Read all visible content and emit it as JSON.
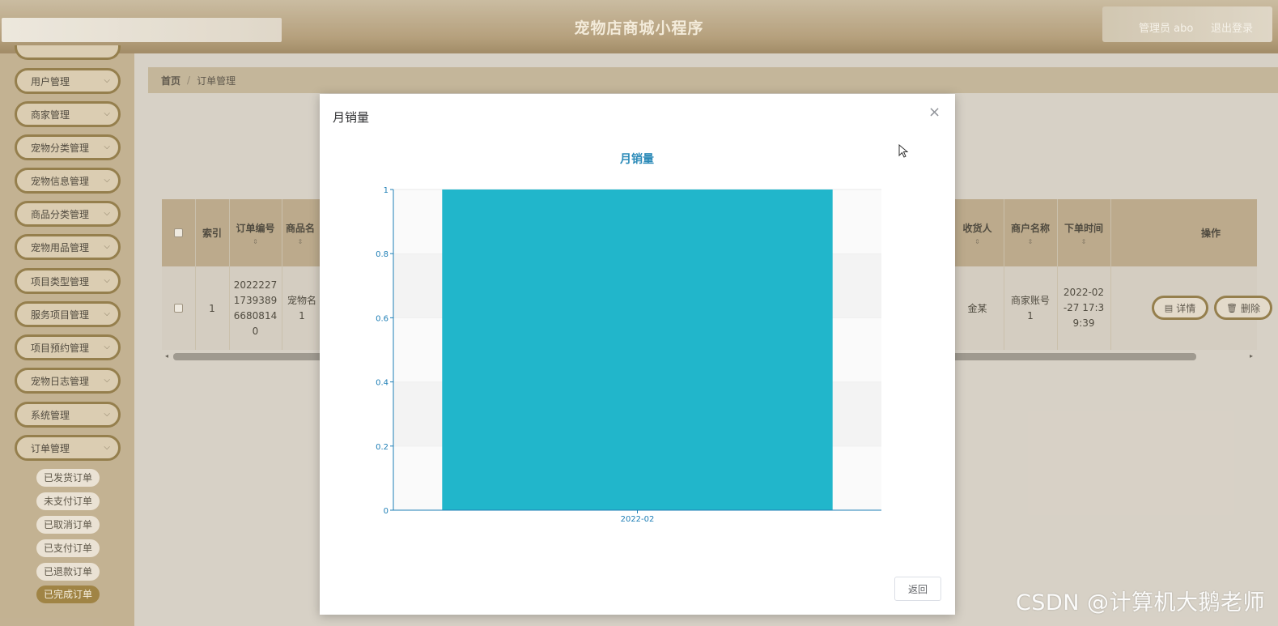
{
  "app": {
    "title": "宠物店商城小程序",
    "user": "管理员 abo",
    "logout": "退出登录"
  },
  "sidebar": {
    "items": [
      {
        "label": "用户管理"
      },
      {
        "label": "商家管理"
      },
      {
        "label": "宠物分类管理"
      },
      {
        "label": "宠物信息管理"
      },
      {
        "label": "商品分类管理"
      },
      {
        "label": "宠物用品管理"
      },
      {
        "label": "项目类型管理"
      },
      {
        "label": "服务项目管理"
      },
      {
        "label": "项目预约管理"
      },
      {
        "label": "宠物日志管理"
      },
      {
        "label": "系统管理"
      },
      {
        "label": "订单管理"
      }
    ],
    "sub_items": [
      {
        "label": "已发货订单",
        "active": false
      },
      {
        "label": "未支付订单",
        "active": false
      },
      {
        "label": "已取消订单",
        "active": false
      },
      {
        "label": "已支付订单",
        "active": false
      },
      {
        "label": "已退款订单",
        "active": false
      },
      {
        "label": "已完成订单",
        "active": true
      }
    ]
  },
  "breadcrumb": {
    "home": "首页",
    "separator": "/",
    "current": "订单管理"
  },
  "table": {
    "headers": {
      "index": "索引",
      "order_no": "订单编号",
      "goods_name": "商品名",
      "receiver": "收货人",
      "merchant_name": "商户名称",
      "order_time": "下单时间",
      "actions": "操作"
    },
    "sort_icon": "⇕",
    "row": {
      "index": "1",
      "order_no": "2022227173938966808140",
      "goods_name": "宠物名1",
      "receiver": "金某",
      "merchant_name": "商家账号1",
      "order_time": "2022-02-27 17:39:39",
      "detail_btn": "详情",
      "delete_btn": "删除"
    }
  },
  "modal": {
    "title": "月销量",
    "close": "×",
    "back_button": "返回"
  },
  "chart_data": {
    "type": "bar",
    "title": "月销量",
    "categories": [
      "2022-02"
    ],
    "values": [
      1
    ],
    "ylim": [
      0,
      1
    ],
    "yticks": [
      "0",
      "0.2",
      "0.4",
      "0.6",
      "0.8",
      "1"
    ],
    "xlabel": "",
    "ylabel": "",
    "bar_color": "#21b6cb",
    "axis_color": "#1f7fb6",
    "grid": true,
    "legend": "none"
  },
  "watermark": "CSDN @计算机大鹅老师"
}
